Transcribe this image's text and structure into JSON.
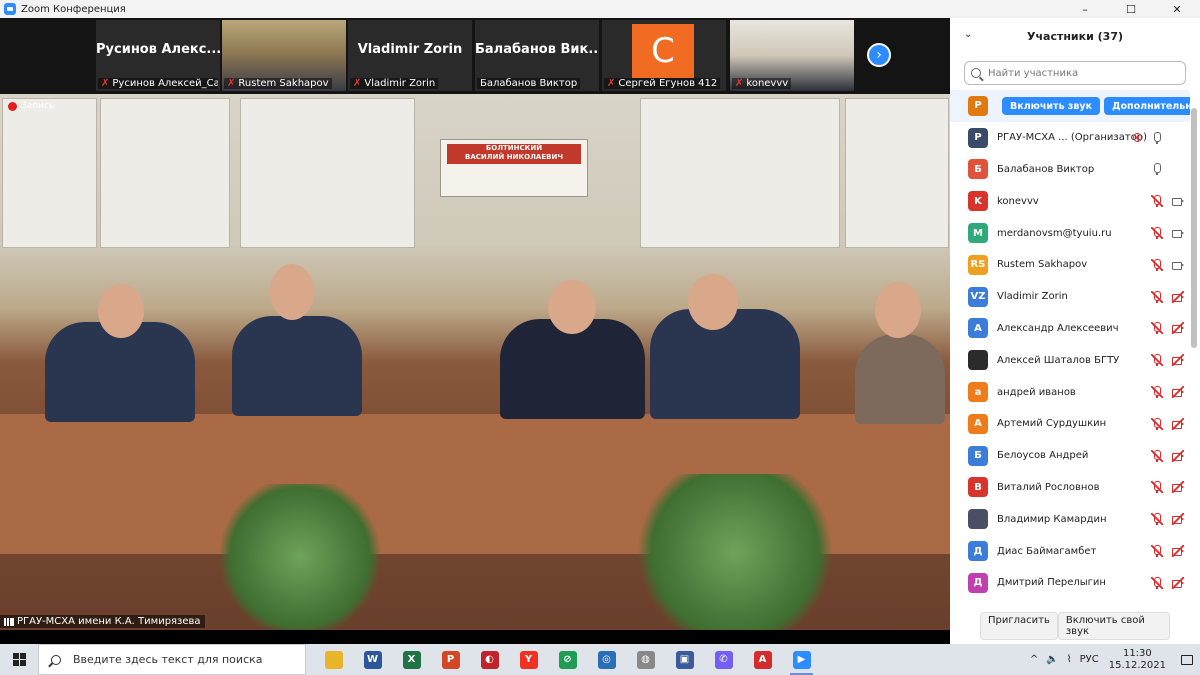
{
  "window": {
    "title": "Zoom Конференция",
    "controls": [
      "–",
      "☐",
      "✕"
    ]
  },
  "thumbnails": [
    {
      "big_name": "Русинов Алекс...",
      "label": "Русинов Алексей_Сар...",
      "type": "name"
    },
    {
      "big_name": "",
      "label": "Rustem Sakhapov",
      "type": "photo"
    },
    {
      "big_name": "Vladimir Zorin",
      "label": "Vladimir Zorin",
      "type": "name"
    },
    {
      "big_name": "Балабанов Вик...",
      "label": "Балабанов Виктор",
      "type": "name"
    },
    {
      "big_name": "",
      "label": "Сергей Егунов 412",
      "type": "avatar",
      "avatar_letter": "С",
      "avatar_color": "#f26b22"
    },
    {
      "big_name": "",
      "label": "konevvv",
      "type": "photo2"
    }
  ],
  "next_glyph": "›",
  "recording": {
    "label": "Запись"
  },
  "plaque": {
    "line1": "БОЛТИНСКИЙ",
    "line2": "ВАСИЛИЙ НИКОЛАЕВИЧ"
  },
  "active_speaker": {
    "label": "РГАУ-МСХА имени К.А. Тимирязева"
  },
  "panel": {
    "title": "Участники (37)",
    "collapse_glyph": "⌄",
    "search_placeholder": "Найти участника",
    "hover_row": {
      "avatar": "Р",
      "color": "#e07a10",
      "unmute_label": "Включить звук",
      "more_label": "Дополнительно"
    },
    "participants": [
      {
        "avatar": "Р",
        "color": "#3a4a6b",
        "name": "РГАУ-МСХА ...  (Организатор)",
        "recording": true,
        "mic": "on",
        "cam": "none"
      },
      {
        "avatar": "Б",
        "color": "#e0533a",
        "name": "Балабанов Виктор",
        "recording": false,
        "mic": "on",
        "cam": "none"
      },
      {
        "avatar": "K",
        "color": "#d9342b",
        "name": "konevvv",
        "recording": false,
        "mic": "off",
        "cam": "on"
      },
      {
        "avatar": "M",
        "color": "#2fa87a",
        "name": "merdanovsm@tyuiu.ru",
        "recording": false,
        "mic": "off",
        "cam": "on"
      },
      {
        "avatar": "RS",
        "color": "#f0a020",
        "name": "Rustem Sakhapov",
        "recording": false,
        "mic": "off",
        "cam": "on"
      },
      {
        "avatar": "VZ",
        "color": "#3b7dd8",
        "name": "Vladimir Zorin",
        "recording": false,
        "mic": "off",
        "cam": "off"
      },
      {
        "avatar": "А",
        "color": "#3b7dd8",
        "name": "Александр Алексеевич",
        "recording": false,
        "mic": "off",
        "cam": "off"
      },
      {
        "avatar": "",
        "color": "#2b2b2b",
        "name": "Алексей Шаталов БГТУ",
        "recording": false,
        "mic": "off",
        "cam": "off"
      },
      {
        "avatar": "а",
        "color": "#f07b1a",
        "name": "андрей иванов",
        "recording": false,
        "mic": "off",
        "cam": "off"
      },
      {
        "avatar": "А",
        "color": "#f07b1a",
        "name": "Артемий Сурдушкин",
        "recording": false,
        "mic": "off",
        "cam": "off"
      },
      {
        "avatar": "Б",
        "color": "#3b7dd8",
        "name": "Белоусов Андрей",
        "recording": false,
        "mic": "off",
        "cam": "off"
      },
      {
        "avatar": "В",
        "color": "#d9342b",
        "name": "Виталий Рословнов",
        "recording": false,
        "mic": "off",
        "cam": "off"
      },
      {
        "avatar": "",
        "color": "#4b4f66",
        "name": "Владимир Камардин",
        "recording": false,
        "mic": "off",
        "cam": "off"
      },
      {
        "avatar": "Д",
        "color": "#3b7dd8",
        "name": "Диас Баймагамбет",
        "recording": false,
        "mic": "off",
        "cam": "off"
      },
      {
        "avatar": "Д",
        "color": "#c040b0",
        "name": "Дмитрий Перелыгин",
        "recording": false,
        "mic": "off",
        "cam": "off"
      }
    ],
    "invite_label": "Пригласить",
    "unmute_self_label": "Включить свой звук"
  },
  "taskbar": {
    "search_placeholder": "Введите здесь текст для поиска",
    "apps": [
      {
        "name": "file-explorer",
        "glyph": "",
        "color": "#e8b42a"
      },
      {
        "name": "word",
        "glyph": "W",
        "color": "#2b579a"
      },
      {
        "name": "excel",
        "glyph": "X",
        "color": "#217346"
      },
      {
        "name": "powerpoint",
        "glyph": "P",
        "color": "#d24726"
      },
      {
        "name": "app-red",
        "glyph": "◐",
        "color": "#c0232c"
      },
      {
        "name": "yandex-browser",
        "glyph": "Y",
        "color": "#ef3124"
      },
      {
        "name": "app-green",
        "glyph": "⊘",
        "color": "#1f9d55"
      },
      {
        "name": "app-blue-globe",
        "glyph": "◎",
        "color": "#2a6fb5"
      },
      {
        "name": "app-chrome-like",
        "glyph": "◍",
        "color": "#888888"
      },
      {
        "name": "save-app",
        "glyph": "▣",
        "color": "#3a5a9a"
      },
      {
        "name": "viber",
        "glyph": "✆",
        "color": "#7360f2"
      },
      {
        "name": "acrobat",
        "glyph": "A",
        "color": "#d22c2c"
      },
      {
        "name": "zoom",
        "glyph": "▶",
        "color": "#2d8cff",
        "active": true
      }
    ],
    "tray": {
      "chevron": "^",
      "volume": "🔈",
      "network": "⌇",
      "lang": "РУС",
      "time": "11:30",
      "date": "15.12.2021"
    }
  }
}
